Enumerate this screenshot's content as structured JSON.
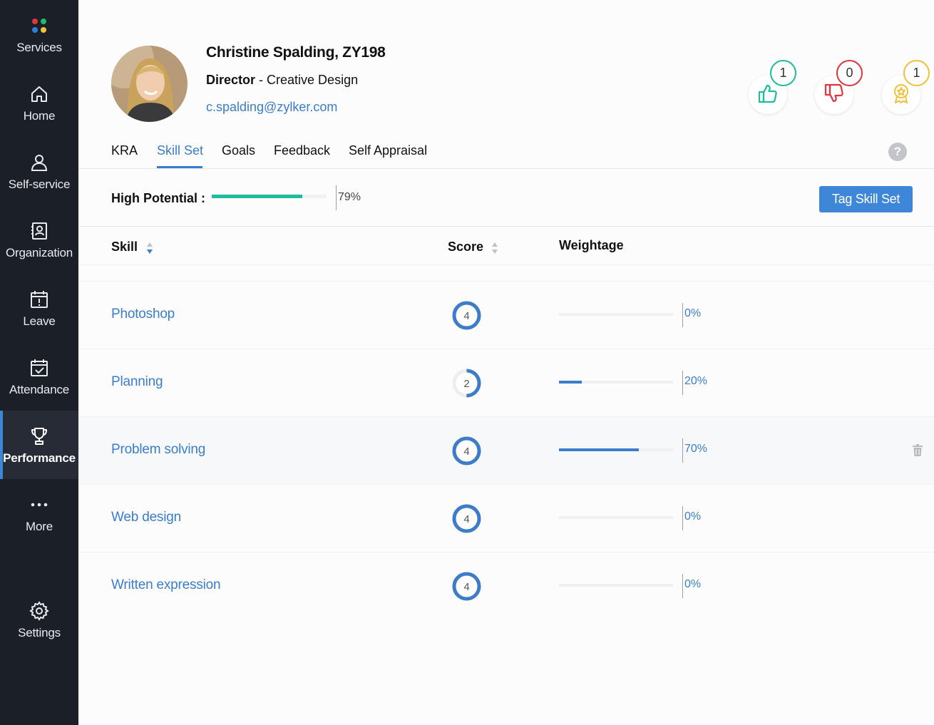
{
  "sidebar": {
    "items": [
      {
        "label": "Services",
        "icon": "services-dots-icon"
      },
      {
        "label": "Home",
        "icon": "home-icon"
      },
      {
        "label": "Self-service",
        "icon": "user-icon"
      },
      {
        "label": "Organization",
        "icon": "contact-card-icon"
      },
      {
        "label": "Leave",
        "icon": "calendar-alert-icon"
      },
      {
        "label": "Attendance",
        "icon": "calendar-check-icon"
      },
      {
        "label": "Performance",
        "icon": "trophy-icon",
        "active": true
      },
      {
        "label": "More",
        "icon": "more-dots-icon"
      },
      {
        "label": "Settings",
        "icon": "gear-icon"
      }
    ]
  },
  "profile": {
    "name": "Christine Spalding, ZY198",
    "title": "Director",
    "separator": " - ",
    "department": "Creative Design",
    "email": "c.spalding@zylker.com"
  },
  "badges": [
    {
      "name": "thumbs-up",
      "count": "1",
      "color": "#1cbc9c"
    },
    {
      "name": "thumbs-down",
      "count": "0",
      "color": "#e0353f"
    },
    {
      "name": "award",
      "count": "1",
      "color": "#f2c13a"
    }
  ],
  "tabs": [
    {
      "label": "KRA"
    },
    {
      "label": "Skill Set",
      "active": true
    },
    {
      "label": "Goals"
    },
    {
      "label": "Feedback"
    },
    {
      "label": "Self Appraisal"
    }
  ],
  "help_icon_label": "?",
  "high_potential": {
    "label": "High Potential :",
    "value_text": "79%",
    "value": 0.79
  },
  "tag_button_label": "Tag Skill Set",
  "table": {
    "columns": {
      "skill": "Skill",
      "score": "Score",
      "weightage": "Weightage"
    },
    "rows": [
      {
        "skill": "Photoshop",
        "score": "4",
        "score_fraction": 1.0,
        "weightage_text": "0%",
        "weightage": 0
      },
      {
        "skill": "Planning",
        "score": "2",
        "score_fraction": 0.5,
        "weightage_text": "20%",
        "weightage": 0.2
      },
      {
        "skill": "Problem solving",
        "score": "4",
        "score_fraction": 1.0,
        "weightage_text": "70%",
        "weightage": 0.7,
        "highlighted": true
      },
      {
        "skill": "Web design",
        "score": "4",
        "score_fraction": 1.0,
        "weightage_text": "0%",
        "weightage": 0
      },
      {
        "skill": "Written expression",
        "score": "4",
        "score_fraction": 1.0,
        "weightage_text": "0%",
        "weightage": 0
      }
    ]
  },
  "colors": {
    "accent": "#3b7dcc",
    "sidebar": "#1b1f28",
    "progress_green": "#1cbc9c"
  }
}
